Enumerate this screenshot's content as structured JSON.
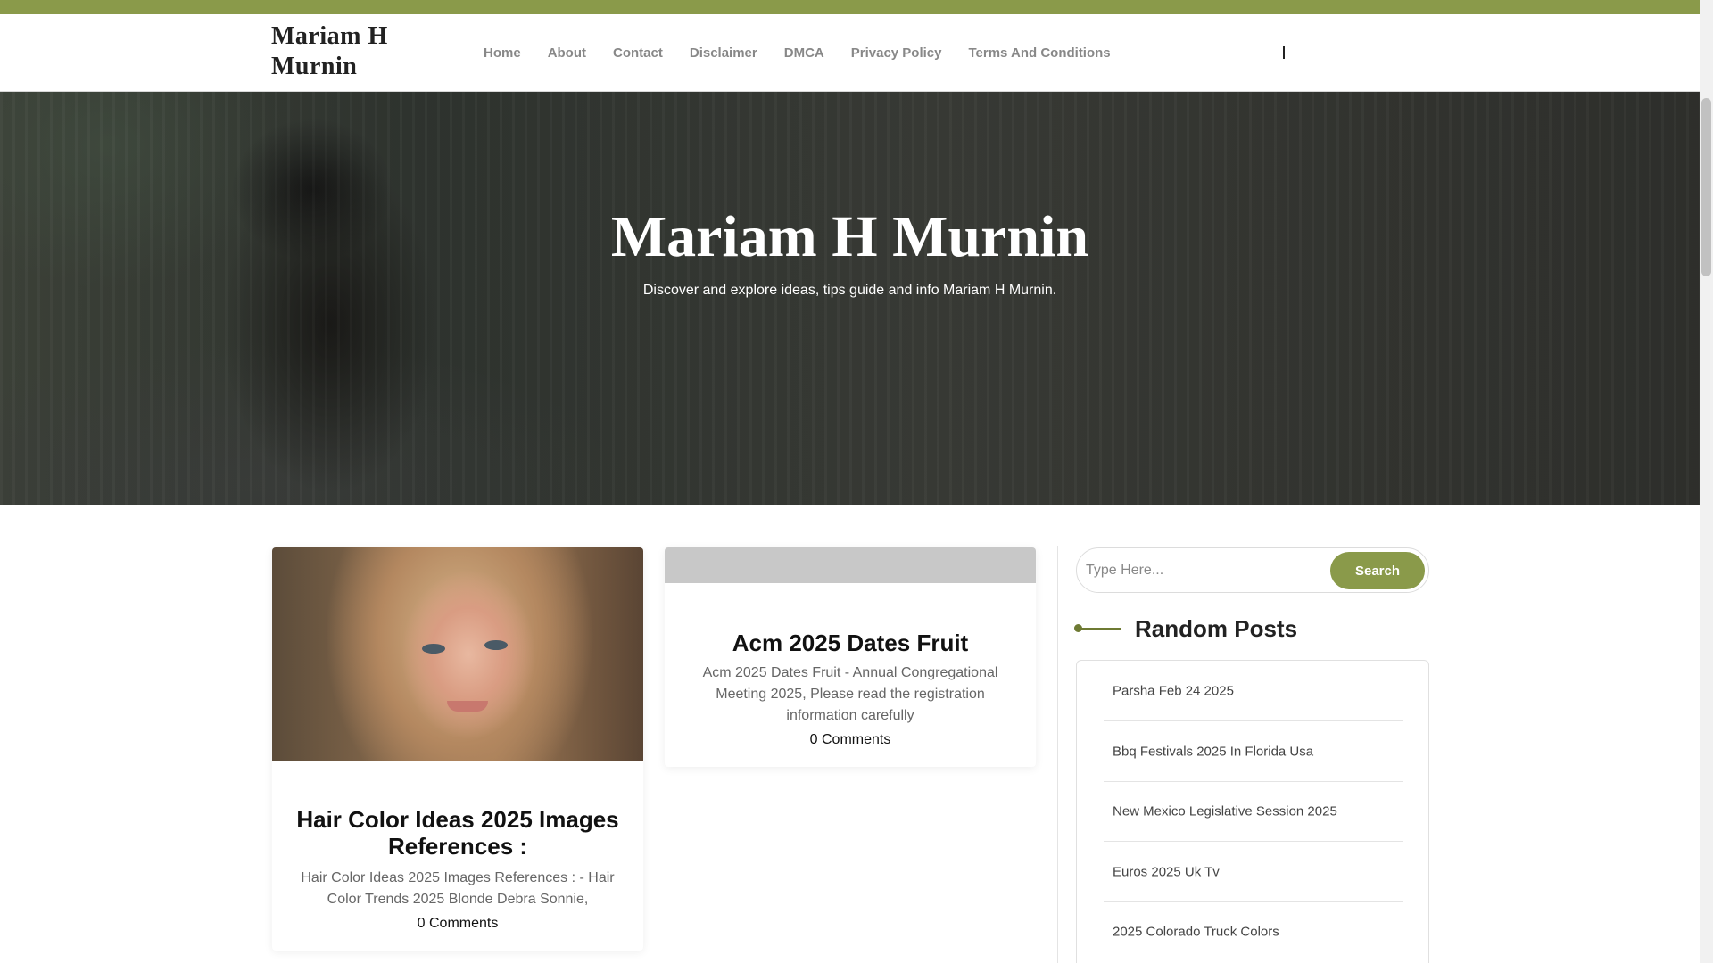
{
  "site": {
    "title": "Mariam H Murnin"
  },
  "colors": {
    "accent": "#8a9a4a",
    "accent_dark": "#6e7a33"
  },
  "nav": {
    "items": [
      "Home",
      "About",
      "Contact",
      "Disclaimer",
      "DMCA",
      "Privacy Policy",
      "Terms And Conditions"
    ]
  },
  "hero": {
    "title": "Mariam H Murnin",
    "subtitle": "Discover and explore ideas, tips guide and info Mariam H Murnin."
  },
  "posts": [
    {
      "title": "Hair Color Ideas 2025 Images References :",
      "excerpt": "Hair Color Ideas 2025 Images References : - Hair Color Trends 2025 Blonde Debra Sonnie,",
      "comments": "0 Comments"
    },
    {
      "title": "Acm 2025 Dates Fruit",
      "excerpt": "Acm 2025 Dates Fruit - Annual Congregational Meeting 2025, Please read the registration information carefully",
      "comments": "0 Comments"
    }
  ],
  "sidebar": {
    "search": {
      "placeholder": "Type Here...",
      "button_label": "Search"
    },
    "random_posts": {
      "title": "Random Posts",
      "items": [
        "Parsha Feb 24 2025",
        "Bbq Festivals 2025 In Florida Usa",
        "New Mexico Legislative Session 2025",
        "Euros 2025 Uk Tv",
        "2025 Colorado Truck Colors"
      ]
    }
  }
}
